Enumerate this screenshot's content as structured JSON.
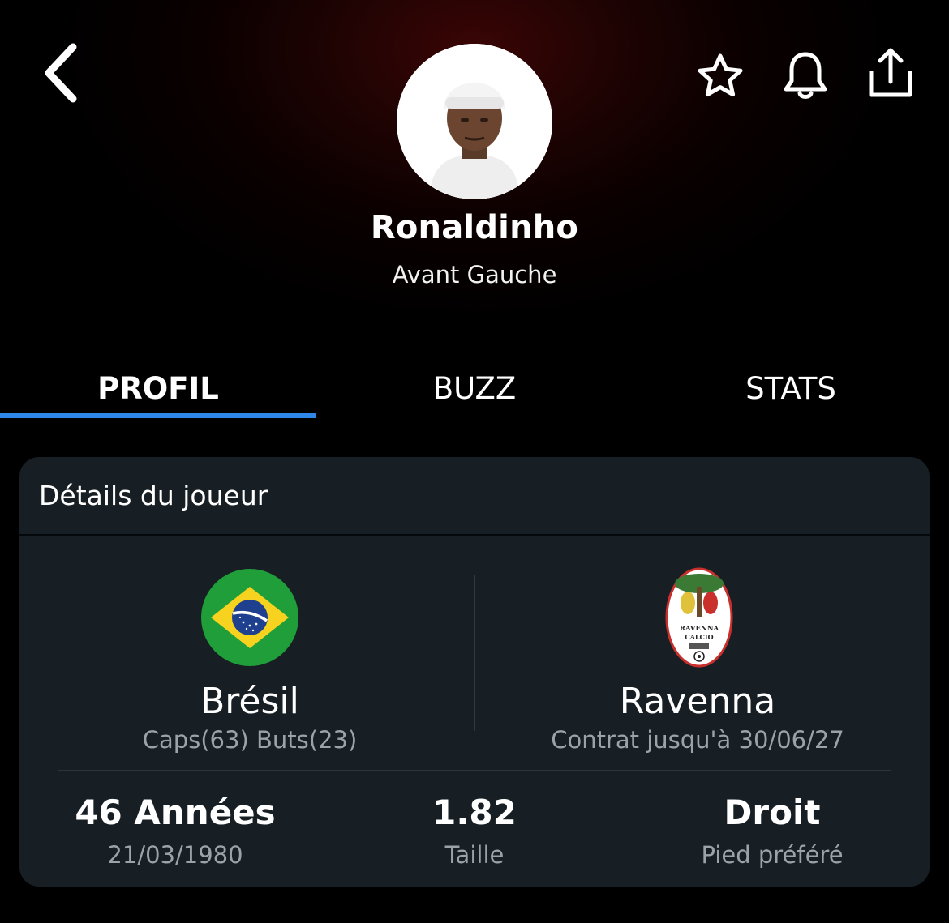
{
  "header": {
    "player_name": "Ronaldinho",
    "player_position": "Avant Gauche"
  },
  "icons": {
    "back": "back-chevron-icon",
    "favorite": "star-icon",
    "notifications": "bell-icon",
    "share": "share-icon"
  },
  "tabs": [
    {
      "label": "PROFIL",
      "active": true
    },
    {
      "label": "BUZZ",
      "active": false
    },
    {
      "label": "STATS",
      "active": false
    }
  ],
  "details": {
    "title": "Détails du joueur",
    "nation": {
      "name": "Brésil",
      "sub": "Caps(63) Buts(23)"
    },
    "club": {
      "name": "Ravenna",
      "sub": "Contrat jusqu'à 30/06/27",
      "logo_text": "RAVENNA CALCIO"
    },
    "stats": [
      {
        "value": "46 Années",
        "label": "21/03/1980"
      },
      {
        "value": "1.82",
        "label": "Taille"
      },
      {
        "value": "Droit",
        "label": "Pied préféré"
      }
    ]
  },
  "colors": {
    "accent": "#2e86e8",
    "card_bg": "#171f24",
    "muted_text": "#9aa3a8"
  }
}
